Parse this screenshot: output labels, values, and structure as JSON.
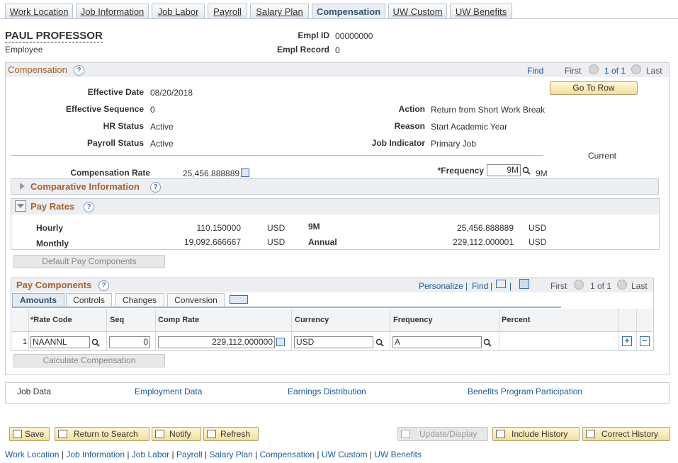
{
  "tabs": [
    {
      "label": "Work Location",
      "active": false
    },
    {
      "label": "Job Information",
      "active": false
    },
    {
      "label": "Job Labor",
      "active": false
    },
    {
      "label": "Payroll",
      "active": false
    },
    {
      "label": "Salary Plan",
      "active": false
    },
    {
      "label": "Compensation",
      "active": true
    },
    {
      "label": "UW Custom",
      "active": false
    },
    {
      "label": "UW Benefits",
      "active": false
    }
  ],
  "employee": {
    "name": "PAUL PROFESSOR",
    "type": "Employee",
    "empl_id_label": "Empl ID",
    "empl_id": "00000000",
    "empl_record_label": "Empl Record",
    "empl_record": "0"
  },
  "compensation": {
    "title": "Compensation",
    "find": "Find",
    "first": "First",
    "count": "1 of 1",
    "last": "Last",
    "go_to_row": "Go To Row",
    "effective_date_label": "Effective Date",
    "effective_date": "08/20/2018",
    "effective_sequence_label": "Effective Sequence",
    "effective_sequence": "0",
    "hr_status_label": "HR Status",
    "hr_status": "Active",
    "payroll_status_label": "Payroll Status",
    "payroll_status": "Active",
    "action_label": "Action",
    "action": "Return from Short Work Break",
    "reason_label": "Reason",
    "reason": "Start Academic Year",
    "job_indicator_label": "Job Indicator",
    "job_indicator": "Primary Job",
    "current": "Current",
    "comp_rate_label": "Compensation Rate",
    "comp_rate": "25,456.888889",
    "frequency_label": "*Frequency",
    "frequency": "9M",
    "frequency_desc": "9M"
  },
  "comparative": {
    "title": "Comparative Information"
  },
  "pay_rates": {
    "title": "Pay Rates",
    "hourly_label": "Hourly",
    "hourly": "110.150000",
    "hourly_cur": "USD",
    "monthly_label": "Monthly",
    "monthly": "19,092.666667",
    "monthly_cur": "USD",
    "freq_label": "9M",
    "freq_value": "25,456.888889",
    "freq_cur": "USD",
    "annual_label": "Annual",
    "annual": "229,112.000001",
    "annual_cur": "USD"
  },
  "default_pay_components": "Default Pay Components",
  "pay_components": {
    "title": "Pay Components",
    "personalize": "Personalize",
    "find": "Find",
    "first": "First",
    "count": "1 of 1",
    "last": "Last",
    "subtabs": [
      "Amounts",
      "Controls",
      "Changes",
      "Conversion"
    ],
    "headers": [
      "*Rate Code",
      "Seq",
      "Comp Rate",
      "Currency",
      "Frequency",
      "Percent"
    ],
    "rows": [
      {
        "num": "1",
        "rate_code": "NAANNL",
        "seq": "0",
        "comp_rate": "229,112.000000",
        "currency": "USD",
        "frequency": "A",
        "percent": ""
      }
    ]
  },
  "calculate_compensation": "Calculate Compensation",
  "links_box": {
    "job_data": "Job Data",
    "employment_data": "Employment Data",
    "earnings_distribution": "Earnings Distribution",
    "benefits_program": "Benefits Program Participation"
  },
  "toolbar": {
    "save": "Save",
    "return_to_search": "Return to Search",
    "notify": "Notify",
    "refresh": "Refresh",
    "update_display": "Update/Display",
    "include_history": "Include History",
    "correct_history": "Correct History"
  },
  "bottom_links": [
    "Work Location",
    "Job Information",
    "Job Labor",
    "Payroll",
    "Salary Plan",
    "Compensation",
    "UW Custom",
    "UW Benefits"
  ]
}
